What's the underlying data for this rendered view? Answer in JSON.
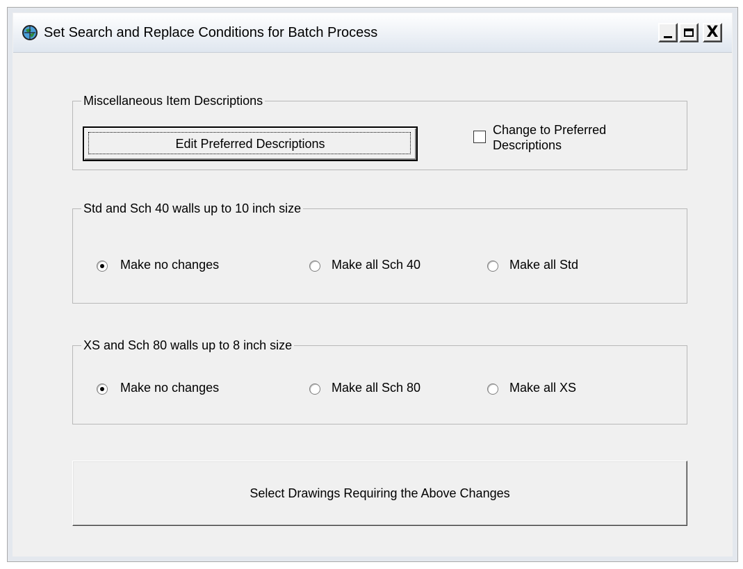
{
  "window": {
    "title": "Set Search and Replace Conditions for Batch Process",
    "close_glyph": "X"
  },
  "misc_group": {
    "legend": "Miscellaneous Item Descriptions",
    "edit_button_label": "Edit Preferred Descriptions",
    "checkbox_label": "Change to Preferred Descriptions",
    "checkbox_checked": false
  },
  "std_group": {
    "legend": "Std and Sch 40 walls up to 10 inch size",
    "options": [
      {
        "label": "Make no changes",
        "checked": true
      },
      {
        "label": "Make all Sch 40",
        "checked": false
      },
      {
        "label": "Make all Std",
        "checked": false
      }
    ]
  },
  "xs_group": {
    "legend": "XS and Sch 80 walls up to 8 inch size",
    "options": [
      {
        "label": "Make no changes",
        "checked": true
      },
      {
        "label": "Make all Sch 80",
        "checked": false
      },
      {
        "label": "Make all XS",
        "checked": false
      }
    ]
  },
  "select_button_label": "Select Drawings Requiring the Above Changes",
  "icons": {
    "app": "globe-icon",
    "minimize": "minimize-icon",
    "maximize": "maximize-icon",
    "close": "close-icon"
  }
}
